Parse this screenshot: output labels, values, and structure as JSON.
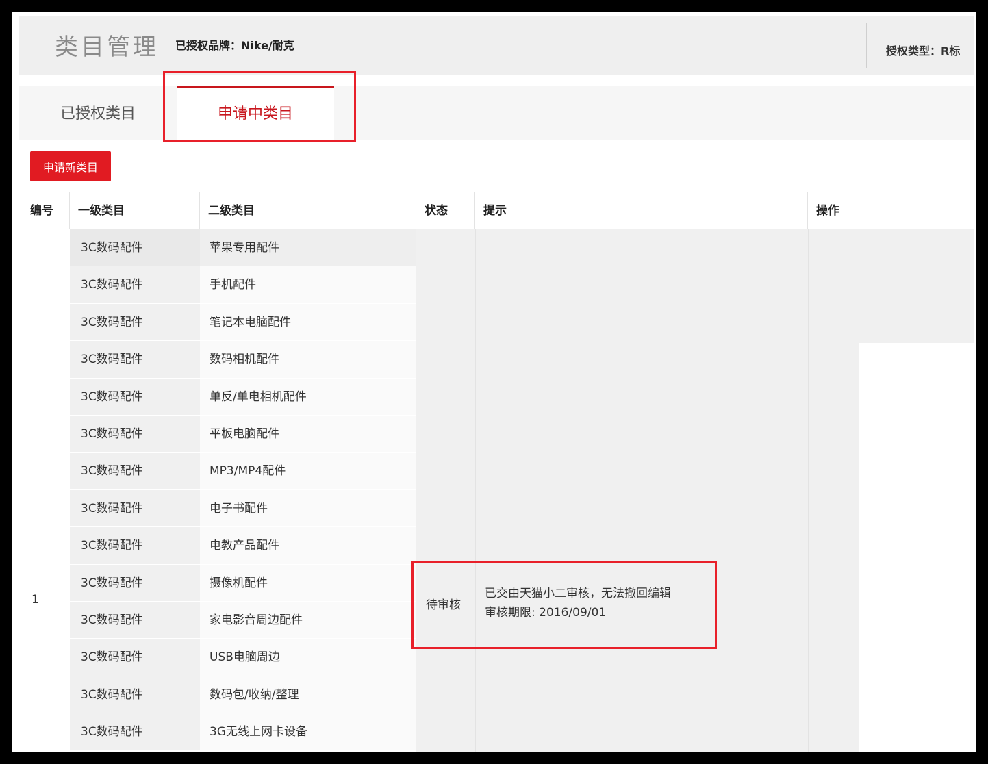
{
  "header": {
    "title": "类目管理",
    "brand": "已授权品牌：Nike/耐克",
    "auth_type": "授权类型：R标"
  },
  "tabs": [
    {
      "label": "已授权类目",
      "active": false
    },
    {
      "label": "申请中类目",
      "active": true
    }
  ],
  "apply_button": "申请新类目",
  "table": {
    "headers": [
      "编号",
      "一级类目",
      "二级类目",
      "状态",
      "提示",
      "操作"
    ],
    "id": "1",
    "status": "待审核",
    "tip_line1": "已交由天猫小二审核，无法撤回编辑",
    "tip_line2": "审核期限: 2016/09/01",
    "rows": [
      {
        "l1": "3C数码配件",
        "l2": "苹果专用配件"
      },
      {
        "l1": "3C数码配件",
        "l2": "手机配件"
      },
      {
        "l1": "3C数码配件",
        "l2": "笔记本电脑配件"
      },
      {
        "l1": "3C数码配件",
        "l2": "数码相机配件"
      },
      {
        "l1": "3C数码配件",
        "l2": "单反/单电相机配件"
      },
      {
        "l1": "3C数码配件",
        "l2": "平板电脑配件"
      },
      {
        "l1": "3C数码配件",
        "l2": "MP3/MP4配件"
      },
      {
        "l1": "3C数码配件",
        "l2": "电子书配件"
      },
      {
        "l1": "3C数码配件",
        "l2": "电教产品配件"
      },
      {
        "l1": "3C数码配件",
        "l2": "摄像机配件"
      },
      {
        "l1": "3C数码配件",
        "l2": "家电影音周边配件"
      },
      {
        "l1": "3C数码配件",
        "l2": "USB电脑周边"
      },
      {
        "l1": "3C数码配件",
        "l2": "数码包/收纳/整理"
      },
      {
        "l1": "3C数码配件",
        "l2": "3G无线上网卡设备"
      }
    ]
  },
  "colors": {
    "accent": "#e11b22",
    "highlight": "#e8202a",
    "active_tab_text": "#c8161d"
  }
}
